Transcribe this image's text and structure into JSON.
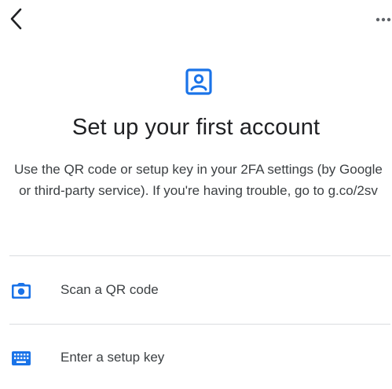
{
  "header": {
    "back_icon": "chevron-left-icon",
    "more_icon": "more-horizontal-icon"
  },
  "hero": {
    "icon": "account-box-icon",
    "title": "Set up your first account",
    "description": "Use the QR code or setup key in your 2FA settings (by Google or third-party service). If you're having trouble, go to g.co/2sv"
  },
  "options": [
    {
      "icon": "camera-icon",
      "label": "Scan a QR code"
    },
    {
      "icon": "keyboard-icon",
      "label": "Enter a setup key"
    }
  ],
  "colors": {
    "accent": "#1a73e8",
    "text_primary": "#202124",
    "text_secondary": "#3c4043",
    "divider": "#dadce0"
  }
}
